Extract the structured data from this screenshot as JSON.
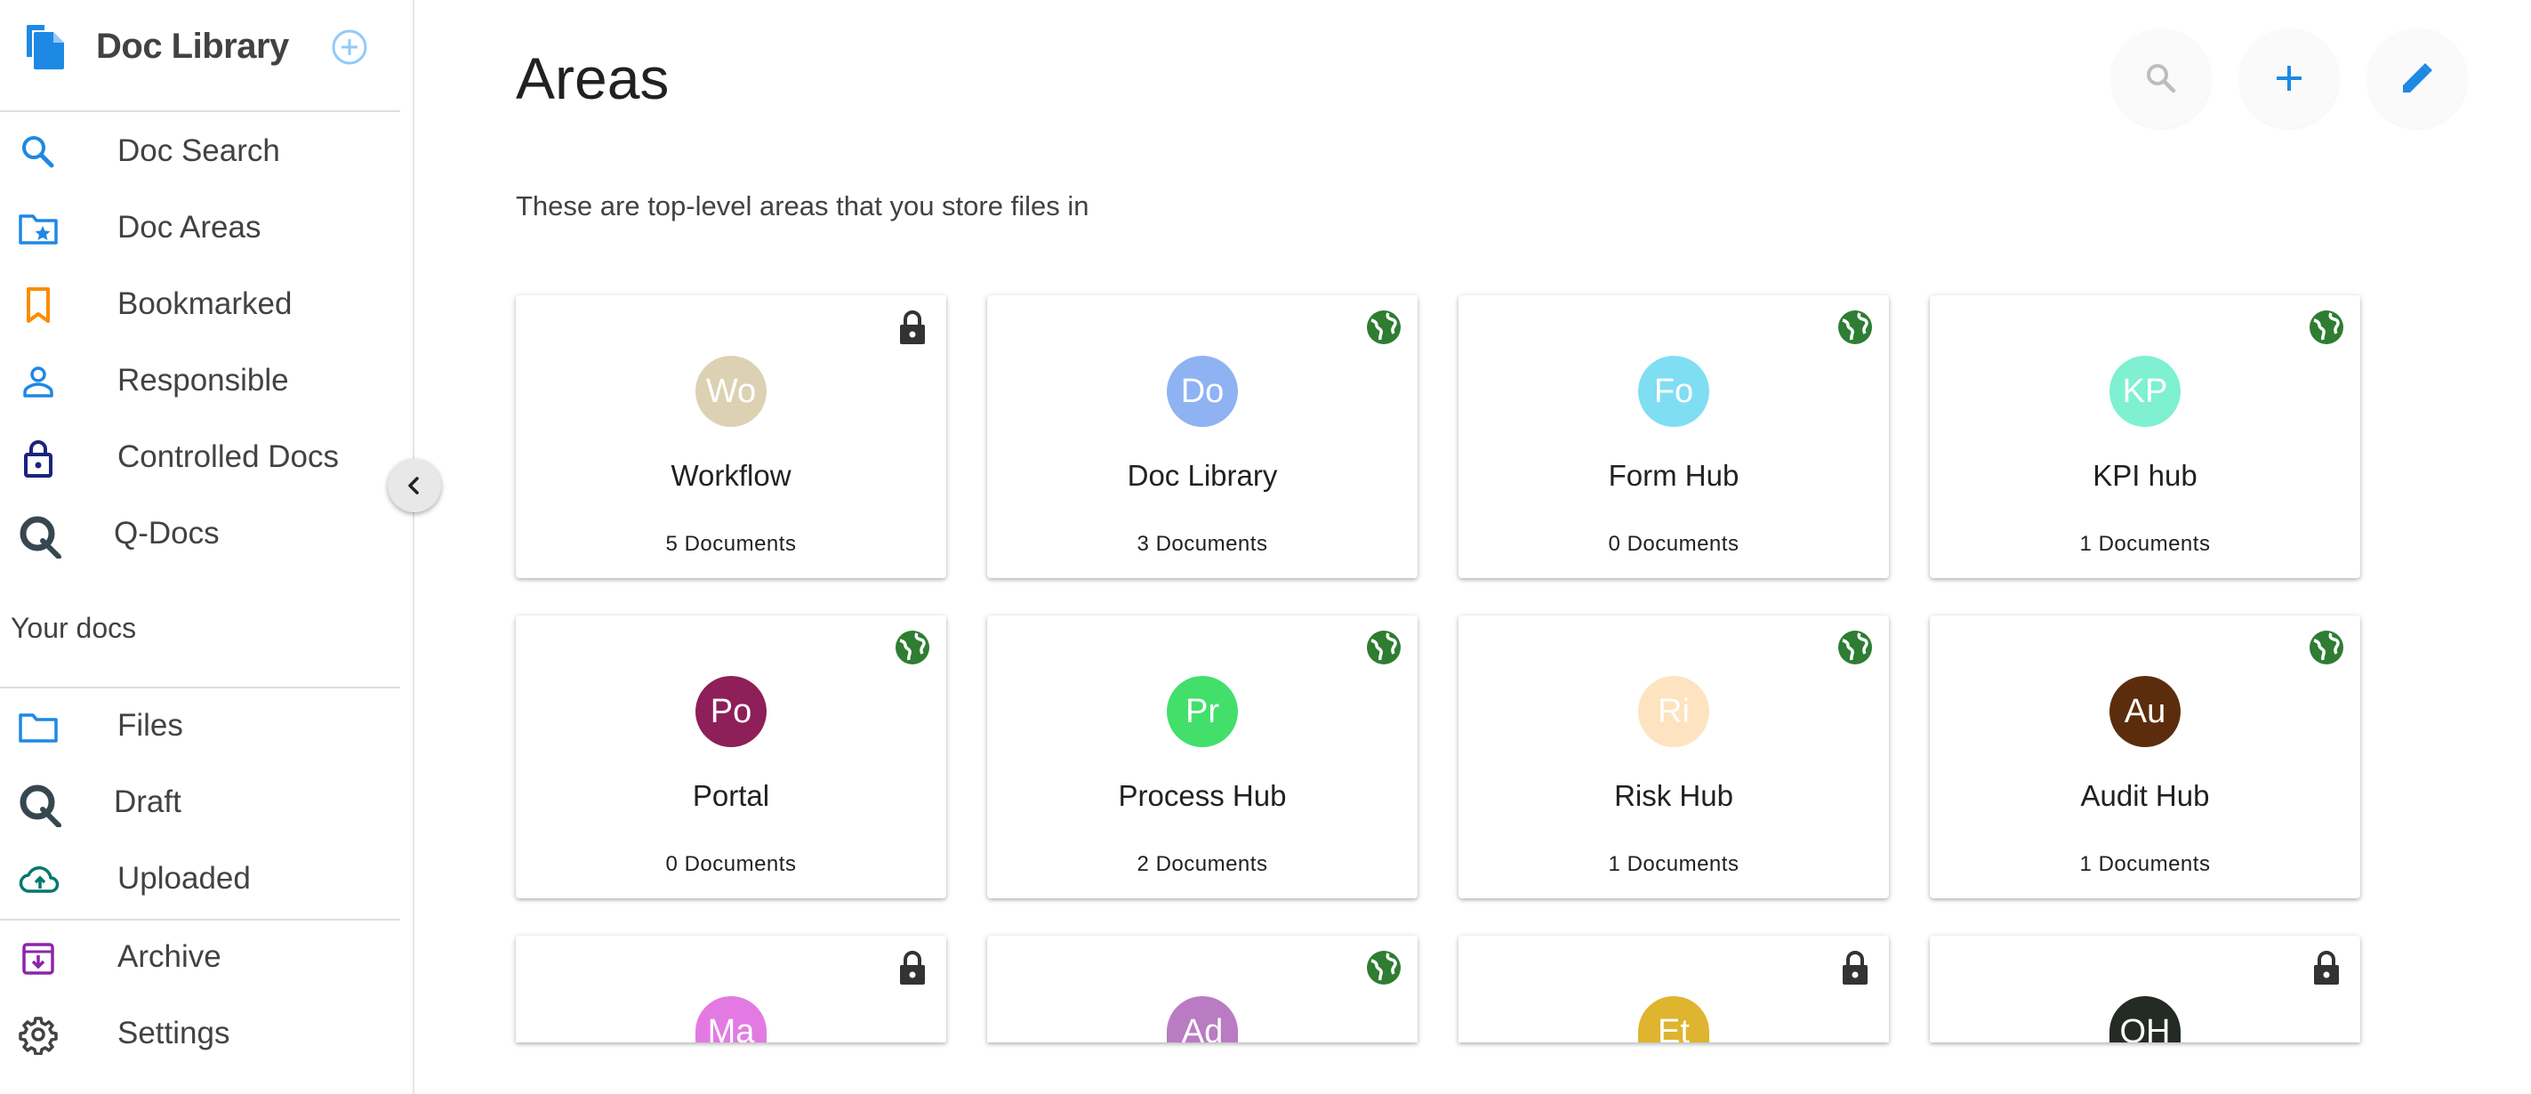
{
  "sidebar": {
    "title": "Doc Library",
    "nav_primary": [
      {
        "label": "Doc Search",
        "icon": "search-icon",
        "color": "#1e88e5"
      },
      {
        "label": "Doc Areas",
        "icon": "folder-star-icon",
        "color": "#1e88e5"
      },
      {
        "label": "Bookmarked",
        "icon": "bookmark-icon",
        "color": "#fb8c00"
      },
      {
        "label": "Responsible",
        "icon": "person-icon",
        "color": "#1e88e5"
      },
      {
        "label": "Controlled Docs",
        "icon": "lock-icon",
        "color": "#1a237e"
      },
      {
        "label": "Q-Docs",
        "icon": "q-logo-icon",
        "color": "#37474f"
      }
    ],
    "section_label": "Your docs",
    "nav_docs": [
      {
        "label": "Files",
        "icon": "folder-icon",
        "color": "#1e88e5"
      },
      {
        "label": "Draft",
        "icon": "q-logo-icon",
        "color": "#37474f"
      },
      {
        "label": "Uploaded",
        "icon": "cloud-upload-icon",
        "color": "#00796b"
      }
    ],
    "nav_bottom": [
      {
        "label": "Archive",
        "icon": "archive-icon",
        "color": "#8e24aa"
      },
      {
        "label": "Settings",
        "icon": "gear-icon",
        "color": "#424242"
      }
    ]
  },
  "main": {
    "title": "Areas",
    "subtitle": "These are top-level areas that you store files in",
    "actions": [
      {
        "icon": "search-icon",
        "color": "#bdbdbd"
      },
      {
        "icon": "plus-icon",
        "color": "#1e88e5"
      },
      {
        "icon": "pencil-icon",
        "color": "#1e88e5"
      }
    ],
    "areas": [
      {
        "initials": "Wo",
        "name": "Workflow",
        "count": "5 Documents",
        "avatar_color": "#ddd1b3",
        "access": "lock"
      },
      {
        "initials": "Do",
        "name": "Doc Library",
        "count": "3 Documents",
        "avatar_color": "#8fb2f2",
        "access": "public"
      },
      {
        "initials": "Fo",
        "name": "Form Hub",
        "count": "0 Documents",
        "avatar_color": "#80def2",
        "access": "public"
      },
      {
        "initials": "KP",
        "name": "KPI hub",
        "count": "1 Documents",
        "avatar_color": "#7ff0d2",
        "access": "public"
      },
      {
        "initials": "Po",
        "name": "Portal",
        "count": "0 Documents",
        "avatar_color": "#8e1f58",
        "access": "public"
      },
      {
        "initials": "Pr",
        "name": "Process Hub",
        "count": "2 Documents",
        "avatar_color": "#43df6b",
        "access": "public"
      },
      {
        "initials": "Ri",
        "name": "Risk Hub",
        "count": "1 Documents",
        "avatar_color": "#fde3bf",
        "access": "public"
      },
      {
        "initials": "Au",
        "name": "Audit Hub",
        "count": "1 Documents",
        "avatar_color": "#5c2d0c",
        "access": "public"
      },
      {
        "initials": "Ma",
        "name": "",
        "count": "",
        "avatar_color": "#e37ae3",
        "access": "lock"
      },
      {
        "initials": "Ad",
        "name": "",
        "count": "",
        "avatar_color": "#b97bc2",
        "access": "public"
      },
      {
        "initials": "Et",
        "name": "",
        "count": "",
        "avatar_color": "#dfb42e",
        "access": "lock"
      },
      {
        "initials": "OH",
        "name": "",
        "count": "",
        "avatar_color": "#242b24",
        "access": "lock"
      }
    ]
  },
  "colors": {
    "lock": "#333333",
    "public": "#2e7d32",
    "accent": "#1e88e5"
  }
}
